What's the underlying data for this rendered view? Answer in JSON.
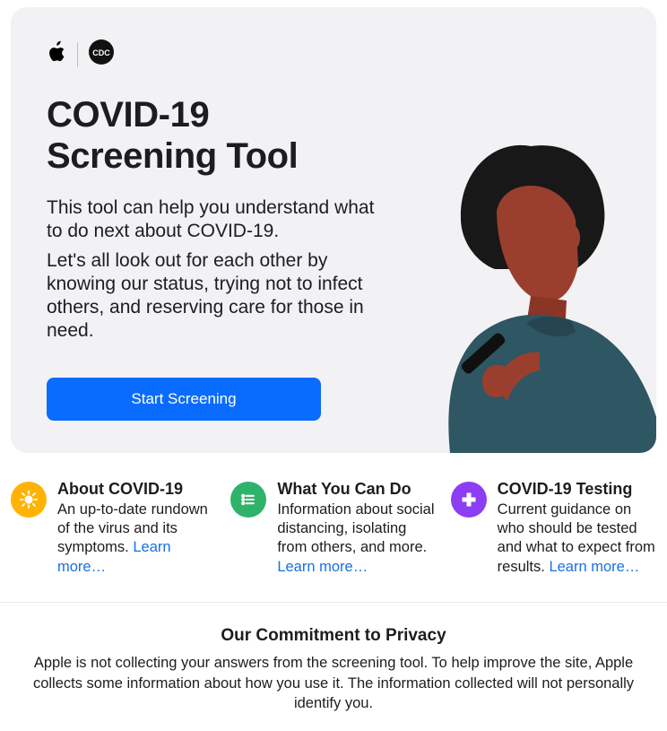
{
  "hero": {
    "title": "COVID-19\nScreening Tool",
    "line1": "This tool can help you understand what to do next about COVID-19.",
    "line2": "Let's all look out for each other by knowing our status, trying not to infect others, and reserving care for those in need.",
    "cta": "Start Screening"
  },
  "logos": {
    "apple": "apple-logo",
    "cdc": "CDC"
  },
  "features": [
    {
      "icon": "virus-icon",
      "icon_color": "#ffb300",
      "title": "About COVID-19",
      "desc": "An up-to-date rundown of the virus and its symptoms.",
      "learn": "Learn more…"
    },
    {
      "icon": "list-icon",
      "icon_color": "#2fb36b",
      "title": "What You Can Do",
      "desc": "Information about social distancing, isolating from others, and more.",
      "learn": "Learn more…"
    },
    {
      "icon": "medical-cross-icon",
      "icon_color": "#8d3df3",
      "title": "COVID-19 Testing",
      "desc": "Current guidance on who should be tested and what to expect from results.",
      "learn": "Learn more…"
    }
  ],
  "privacy": {
    "title": "Our Commitment to Privacy",
    "body": "Apple is not collecting your answers from the screening tool. To help improve the site, Apple collects some information about how you use it. The information collected will not personally identify you."
  }
}
